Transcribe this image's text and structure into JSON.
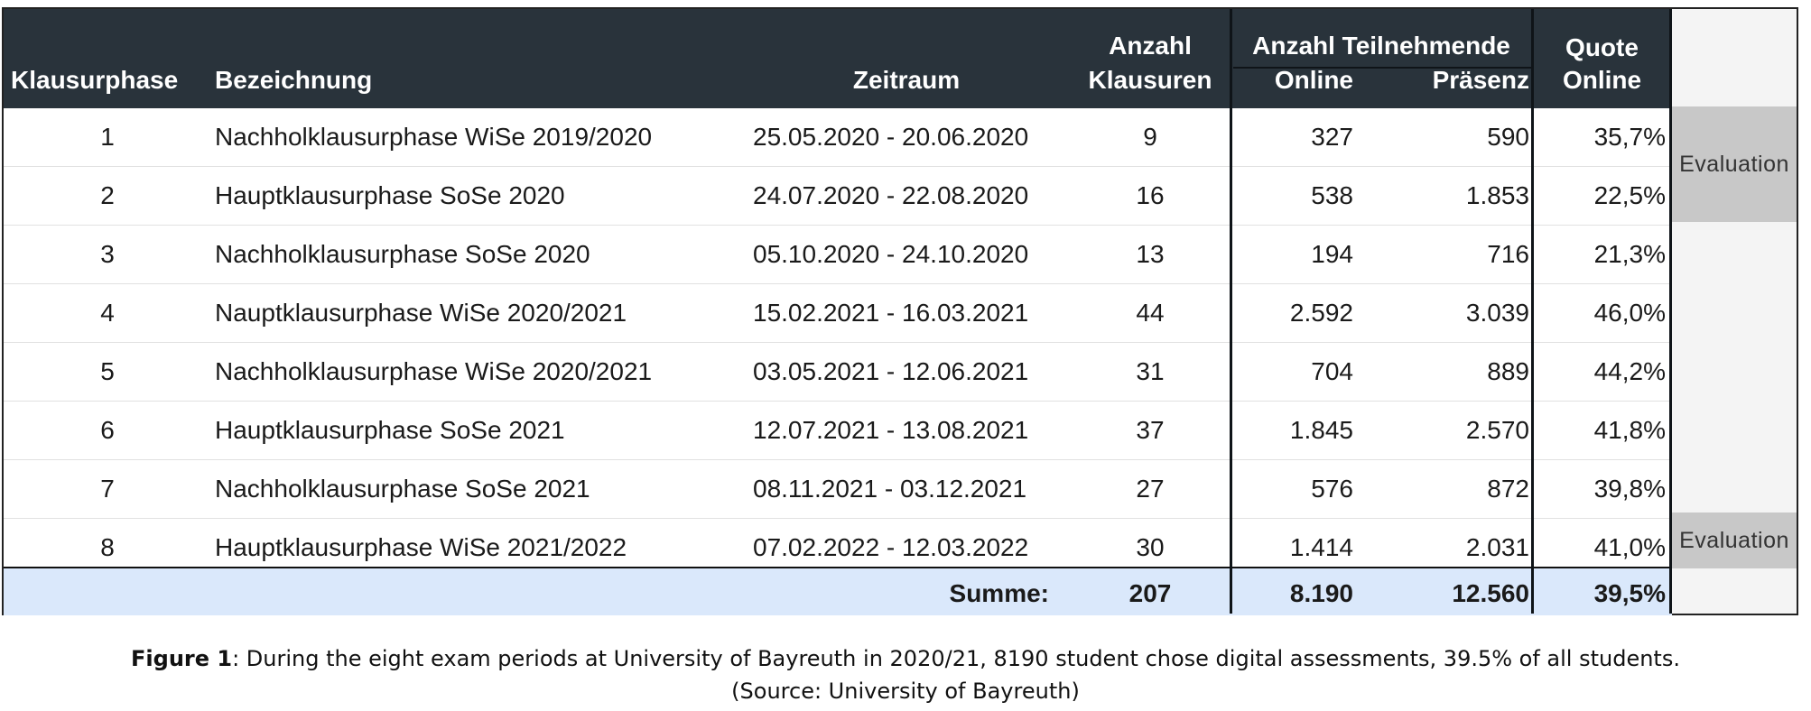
{
  "table": {
    "headers": {
      "phase": "Klausurphase",
      "name": "Bezeichnung",
      "period": "Zeitraum",
      "count_line1": "Anzahl",
      "count_line2": "Klausuren",
      "participants_group": "Anzahl Teilnehmende",
      "online": "Online",
      "presence": "Präsenz",
      "quote_line1": "Quote",
      "quote_line2": "Online"
    },
    "rows": [
      {
        "phase": "1",
        "name": "Nachholklausurphase WiSe 2019/2020",
        "period": "25.05.2020 - 20.06.2020",
        "count": "9",
        "online": "327",
        "presence": "590",
        "quote": "35,7%"
      },
      {
        "phase": "2",
        "name": "Hauptklausurphase SoSe 2020",
        "period": "24.07.2020 - 22.08.2020",
        "count": "16",
        "online": "538",
        "presence": "1.853",
        "quote": "22,5%"
      },
      {
        "phase": "3",
        "name": "Nachholklausurphase SoSe 2020",
        "period": "05.10.2020 - 24.10.2020",
        "count": "13",
        "online": "194",
        "presence": "716",
        "quote": "21,3%"
      },
      {
        "phase": "4",
        "name": "Nauptklausurphase WiSe 2020/2021",
        "period": "15.02.2021 - 16.03.2021",
        "count": "44",
        "online": "2.592",
        "presence": "3.039",
        "quote": "46,0%"
      },
      {
        "phase": "5",
        "name": "Nachholklausurphase WiSe 2020/2021",
        "period": "03.05.2021 - 12.06.2021",
        "count": "31",
        "online": "704",
        "presence": "889",
        "quote": "44,2%"
      },
      {
        "phase": "6",
        "name": "Hauptklausurphase SoSe 2021",
        "period": "12.07.2021 - 13.08.2021",
        "count": "37",
        "online": "1.845",
        "presence": "2.570",
        "quote": "41,8%"
      },
      {
        "phase": "7",
        "name": "Nachholklausurphase SoSe 2021",
        "period": "08.11.2021 - 03.12.2021",
        "count": "27",
        "online": "576",
        "presence": "872",
        "quote": "39,8%"
      },
      {
        "phase": "8",
        "name": "Hauptklausurphase WiSe 2021/2022",
        "period": "07.02.2022 - 12.03.2022",
        "count": "30",
        "online": "1.414",
        "presence": "2.031",
        "quote": "41,0%"
      }
    ],
    "sum": {
      "label": "Summe:",
      "count": "207",
      "online": "8.190",
      "presence": "12.560",
      "quote": "39,5%"
    },
    "evaluation_labels": [
      "Evaluation",
      "Evaluation"
    ]
  },
  "caption": {
    "label": "Figure 1",
    "text": ": During the eight exam periods at University of Bayreuth in 2020/21, 8190 student chose digital assessments, 39.5% of all students.",
    "source": "(Source: University of Bayreuth)"
  },
  "colors": {
    "header_bg": "#29333b",
    "sum_bg": "#dae8fb",
    "evaluation_bg": "#c8c8c8"
  }
}
